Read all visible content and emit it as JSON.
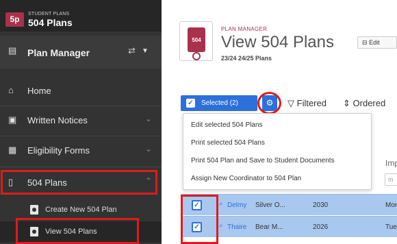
{
  "brand": {
    "logo": "5p",
    "small": "STUDENT PLANS",
    "title": "504 Plans"
  },
  "plan_manager": {
    "label": "Plan Manager"
  },
  "nav": {
    "home": "Home",
    "written_notices": "Written Notices",
    "eligibility_forms": "Eligibility Forms",
    "plans_504": "504 Plans",
    "create_new": "Create New 504 Plan",
    "view_plans": "View 504 Plans"
  },
  "header": {
    "small": "PLAN MANAGER",
    "title": "View 504 Plans",
    "subtitle": "23/24 24/25 Plans",
    "edit_label": "Edit",
    "icon_text": "504"
  },
  "toolbar": {
    "selected_label": "Selected (2)",
    "filtered_label": "Filtered",
    "ordered_label": "Ordered"
  },
  "menu": {
    "items": [
      "Edit selected 504 Plans",
      "Print selected 504 Plans",
      "Print 504 Plan and Save to Student Documents",
      "Assign New Coordinator to 504 Plan"
    ]
  },
  "table": {
    "column_partial": "Imp",
    "filter_placeholder": "m",
    "rows": [
      {
        "name": "Delmy",
        "school": "Silver O...",
        "year": "2030",
        "day": "Mon"
      },
      {
        "name": "Thaire",
        "school": "Bear M...",
        "year": "2026",
        "day": "Tue"
      }
    ]
  },
  "colors": {
    "accent": "#2d6fdb",
    "brand": "#a8324b",
    "highlight": "#e01b1b",
    "sidebar": "#333333"
  }
}
